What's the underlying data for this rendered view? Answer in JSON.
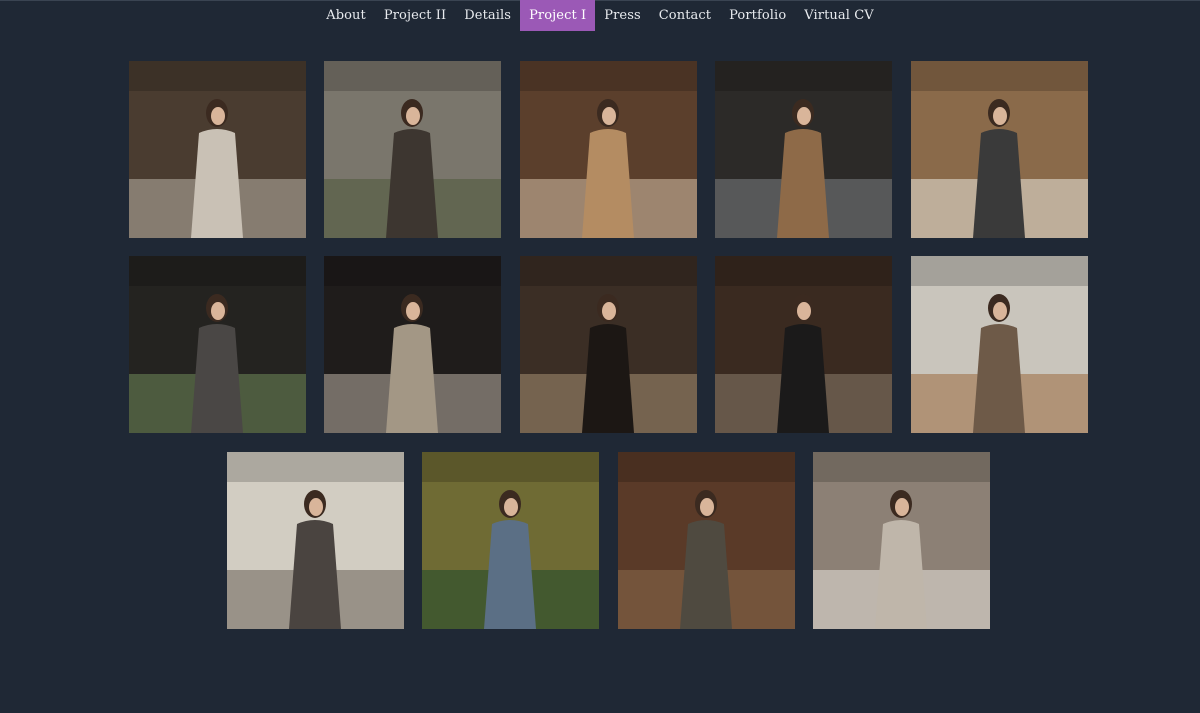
{
  "nav": {
    "items": [
      {
        "label": "About",
        "id": "about"
      },
      {
        "label": "Project II",
        "id": "project-ii"
      },
      {
        "label": "Details",
        "id": "details"
      },
      {
        "label": "Project I",
        "id": "project-i",
        "active": true
      },
      {
        "label": "Press",
        "id": "press"
      },
      {
        "label": "Contact",
        "id": "contact"
      },
      {
        "label": "Portfolio",
        "id": "portfolio"
      },
      {
        "label": "Virtual CV",
        "id": "virtual-cv"
      }
    ],
    "active_color": "#9b59b6"
  },
  "gallery": {
    "photos": [
      {
        "name": "photo-woman-grey-dress-doorway",
        "bg": "#4a3c30",
        "accent": "#b8b0a6",
        "figure": "#c9c1b5"
      },
      {
        "name": "photo-woman-vest-stone-wall",
        "bg": "#7a766c",
        "accent": "#4f5a3c",
        "figure": "#3d3630"
      },
      {
        "name": "photo-woman-tan-dress-window",
        "bg": "#5b3f2c",
        "accent": "#d3bfa7",
        "figure": "#b48c62"
      },
      {
        "name": "photo-woman-graffiti-board",
        "bg": "#2c2a28",
        "accent": "#7b7d82",
        "figure": "#8e6a48"
      },
      {
        "name": "photo-white-coat-rusted-wall",
        "bg": "#8a6a4a",
        "accent": "#e9e5dc",
        "figure": "#3a3a3a"
      },
      {
        "name": "photo-dark-coat-grass",
        "bg": "#242320",
        "accent": "#6f8a5a",
        "figure": "#4a4745"
      },
      {
        "name": "photo-beige-trench-coat",
        "bg": "#1f1c1b",
        "accent": "#b9b1a4",
        "figure": "#a39785"
      },
      {
        "name": "photo-silhouette-shadows",
        "bg": "#3b2e25",
        "accent": "#a58f73",
        "figure": "#1c1714"
      },
      {
        "name": "photo-black-coat-ruins",
        "bg": "#3a2a20",
        "accent": "#8a7b6c",
        "figure": "#1b1a1a"
      },
      {
        "name": "photo-two-women-white-tiles",
        "bg": "#c9c5bc",
        "accent": "#9a6a3e",
        "figure": "#6e5a48"
      },
      {
        "name": "photo-seated-bench-wall",
        "bg": "#d2cdc2",
        "accent": "#6a625a",
        "figure": "#4a4440"
      },
      {
        "name": "photo-green-barrel-sitting",
        "bg": "#6f6b34",
        "accent": "#1f4a2b",
        "figure": "#5b6f85"
      },
      {
        "name": "photo-arch-hallway-bag",
        "bg": "#5a3a28",
        "accent": "#8b6a4a",
        "figure": "#4f4a40"
      },
      {
        "name": "photo-white-bag-detail",
        "bg": "#8c8075",
        "accent": "#e7e2da",
        "figure": "#bfb6aa"
      }
    ]
  }
}
